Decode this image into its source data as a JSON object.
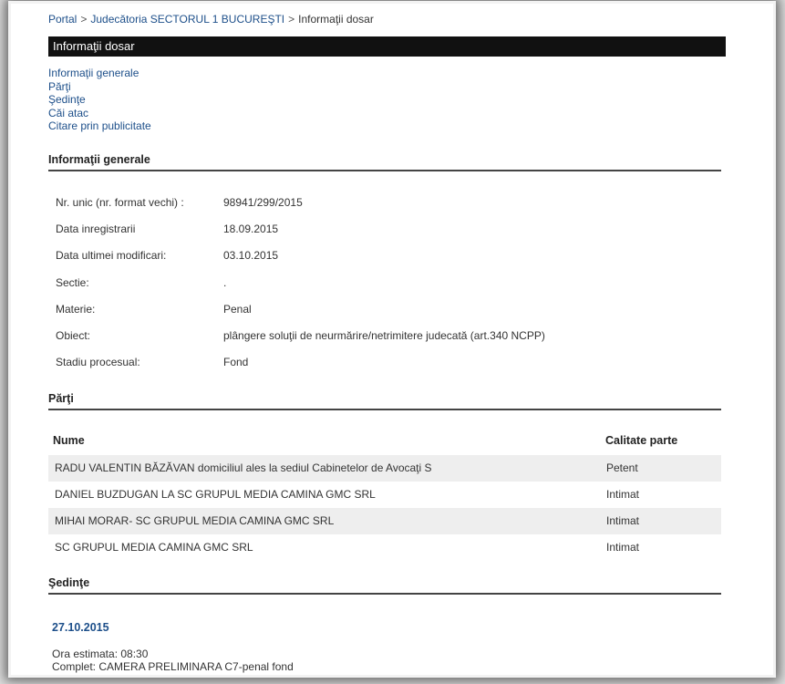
{
  "breadcrumb": {
    "portal": "Portal",
    "sep": ">",
    "court": "Judecătoria SECTORUL 1 BUCUREŞTI",
    "current": "Informaţii dosar"
  },
  "title_bar": "Informaţii dosar",
  "toc": [
    "Informaţii generale",
    "Părţi",
    "Şedinţe",
    "Căi atac",
    "Citare prin publicitate"
  ],
  "general": {
    "heading": "Informaţii generale",
    "rows": [
      {
        "label": "Nr. unic (nr. format vechi) :",
        "value": "98941/299/2015"
      },
      {
        "label": "Data inregistrarii",
        "value": "18.09.2015"
      },
      {
        "label": "Data ultimei modificari:",
        "value": "03.10.2015"
      },
      {
        "label": "Sectie:",
        "value": "."
      },
      {
        "label": "Materie:",
        "value": "Penal"
      },
      {
        "label": "Obiect:",
        "value": "plângere soluţii de neurmărire/netrimitere judecată (art.340 NCPP)"
      },
      {
        "label": "Stadiu procesual:",
        "value": "Fond"
      }
    ]
  },
  "parti": {
    "heading": "Părţi",
    "col_name": "Nume",
    "col_role": "Calitate parte",
    "rows": [
      {
        "name": "RADU VALENTIN BĂZĂVAN domiciliul ales la sediul Cabinetelor de Avocaţi S",
        "role": "Petent"
      },
      {
        "name": "DANIEL BUZDUGAN LA SC GRUPUL MEDIA CAMINA GMC SRL",
        "role": "Intimat"
      },
      {
        "name": "MIHAI MORAR- SC GRUPUL MEDIA CAMINA GMC SRL",
        "role": "Intimat"
      },
      {
        "name": "SC GRUPUL MEDIA CAMINA GMC SRL",
        "role": "Intimat"
      }
    ]
  },
  "sedinte": {
    "heading": "Şedinţe",
    "date": "27.10.2015",
    "ora": "Ora estimata: 08:30",
    "complet": "Complet: CAMERA PRELIMINARA C7-penal fond"
  }
}
